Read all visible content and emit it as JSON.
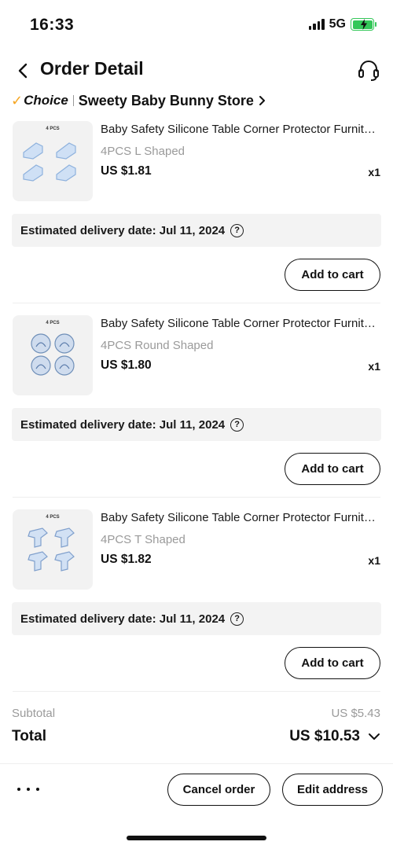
{
  "status_bar": {
    "time": "16:33",
    "network": "5G"
  },
  "header": {
    "title": "Order Detail",
    "back_icon": "chevron-left-icon",
    "support_icon": "headset-icon"
  },
  "store": {
    "badge": "Choice",
    "name": "Sweety Baby Bunny Store"
  },
  "items": [
    {
      "image_label": "4 PCS",
      "title": "Baby Safety Silicone Table Corner Protector Furniture",
      "variant": "4PCS L Shaped",
      "price": "US $1.81",
      "qty": "x1",
      "delivery": "Estimated delivery date: Jul 11, 2024",
      "action": "Add to cart"
    },
    {
      "image_label": "4 PCS",
      "title": "Baby Safety Silicone Table Corner Protector Furniture",
      "variant": "4PCS Round Shaped",
      "price": "US $1.80",
      "qty": "x1",
      "delivery": "Estimated delivery date: Jul 11, 2024",
      "action": "Add to cart"
    },
    {
      "image_label": "4 PCS",
      "title": "Baby Safety Silicone Table Corner Protector Furniture",
      "variant": "4PCS T Shaped",
      "price": "US $1.82",
      "qty": "x1",
      "delivery": "Estimated delivery date: Jul 11, 2024",
      "action": "Add to cart"
    }
  ],
  "summary": {
    "subtotal_label": "Subtotal",
    "subtotal_value": "US $5.43",
    "total_label": "Total",
    "total_value": "US $10.53"
  },
  "footer": {
    "cancel_label": "Cancel order",
    "edit_label": "Edit address"
  },
  "colors": {
    "accent_choice": "#f5a623",
    "battery": "#34c759"
  }
}
